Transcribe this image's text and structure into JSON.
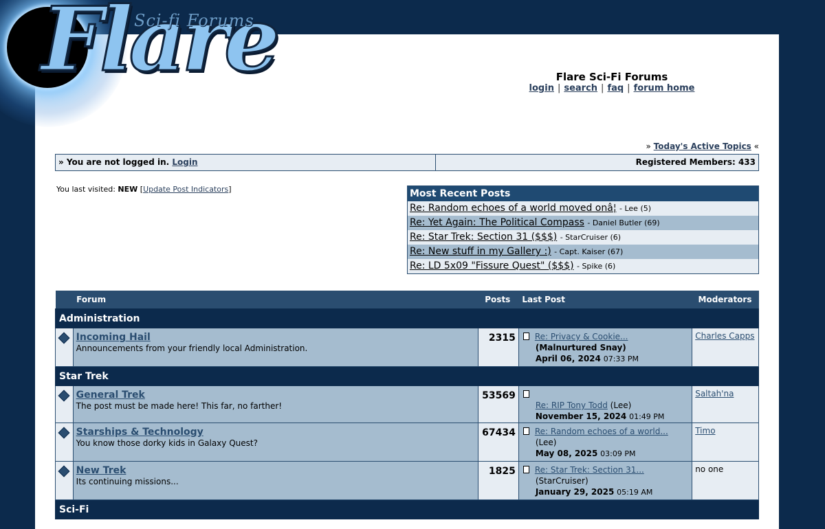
{
  "logo": {
    "word": "Flare",
    "tagline": "Sci-fi Forums"
  },
  "header": {
    "title": "Flare Sci-Fi Forums",
    "nav": [
      {
        "label": "login"
      },
      {
        "label": "search"
      },
      {
        "label": "faq"
      },
      {
        "label": "forum home"
      }
    ]
  },
  "active_topics": {
    "prefix": "»",
    "label": "Today's Active Topics",
    "suffix": "«"
  },
  "login_bar": {
    "status": "» You are not logged in.",
    "login_link": "Login",
    "members": "Registered Members: 433"
  },
  "last_visited": {
    "label": "You last visited:",
    "value": "NEW",
    "update_link": "Update Post Indicators"
  },
  "recent_posts": {
    "title": "Most Recent Posts",
    "items": [
      {
        "title": "Re: Random echoes of a world moved onâ¦",
        "author": "Lee",
        "count": "(5)"
      },
      {
        "title": "Re: Yet Again: The Political Compass",
        "author": "Daniel Butler",
        "count": "(69)"
      },
      {
        "title": "Re: Star Trek: Section 31 ($$$)",
        "author": "StarCruiser",
        "count": "(6)"
      },
      {
        "title": "Re: New stuff in my Gallery :)",
        "author": "Capt. Kaiser",
        "count": "(67)"
      },
      {
        "title": "Re: LD 5x09 \"Fissure Quest\" ($$$)",
        "author": "Spike",
        "count": "(6)"
      }
    ]
  },
  "table": {
    "headers": {
      "forum": "Forum",
      "posts": "Posts",
      "last_post": "Last Post",
      "moderators": "Moderators"
    },
    "categories": [
      {
        "name": "Administration",
        "forums": [
          {
            "name": "Incoming Hail",
            "desc": "Announcements from your friendly local Administration.",
            "posts": "2315",
            "last_title": "Re: Privacy & Cookie...",
            "last_author": "(Malnurtured Snay)",
            "last_date": "April 06, 2024",
            "last_time": "07:33 PM",
            "mod": "Charles Capps"
          }
        ]
      },
      {
        "name": "Star Trek",
        "forums": [
          {
            "name": "General Trek",
            "desc": "The post must be made here! This far, no farther!",
            "posts": "53569",
            "last_title": "Re: RIP Tony Todd",
            "last_author": "(Lee)",
            "last_date": "November 15, 2024",
            "last_time": "01:49 PM",
            "mod": "Saltah'na"
          },
          {
            "name": "Starships & Technology",
            "desc": "You know those dorky kids in Galaxy Quest?",
            "posts": "67434",
            "last_title": "Re: Random echoes of a world...",
            "last_author": "(Lee)",
            "last_date": "May 08, 2025",
            "last_time": "03:09 PM",
            "mod": "Timo"
          },
          {
            "name": "New Trek",
            "desc": "Its continuing missions...",
            "posts": "1825",
            "last_title": "Re: Star Trek: Section 31...",
            "last_author": "(StarCruiser)",
            "last_date": "January 29, 2025",
            "last_time": "05:19 AM",
            "mod": "no one"
          }
        ]
      },
      {
        "name": "Sci-Fi",
        "forums": []
      }
    ]
  },
  "colors": {
    "navy": "#0c2a4c",
    "header_blue": "#2a4d70",
    "row_blue": "#a5bccf",
    "row_light": "#e7edf3"
  }
}
